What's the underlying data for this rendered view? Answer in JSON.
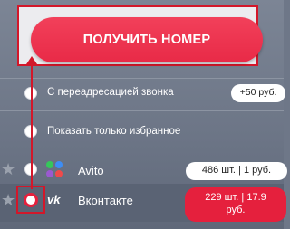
{
  "primary_button": {
    "label": "ПОЛУЧИТЬ НОМЕР"
  },
  "options": [
    {
      "label": "С переадресацией звонка",
      "price": "+50 руб."
    },
    {
      "label": "Показать только избранное"
    }
  ],
  "services": [
    {
      "name": "Avito",
      "count_price": "486 шт. | 1 руб.",
      "icon": "avito-icon"
    },
    {
      "name": "Вконтакте",
      "count_price_line1": "229 шт. | 17.9",
      "count_price_line2": "руб.",
      "icon": "vk-icon"
    }
  ],
  "colors": {
    "accent": "#e5203d",
    "annotation": "#d3172a",
    "panel": "#6e7788"
  }
}
